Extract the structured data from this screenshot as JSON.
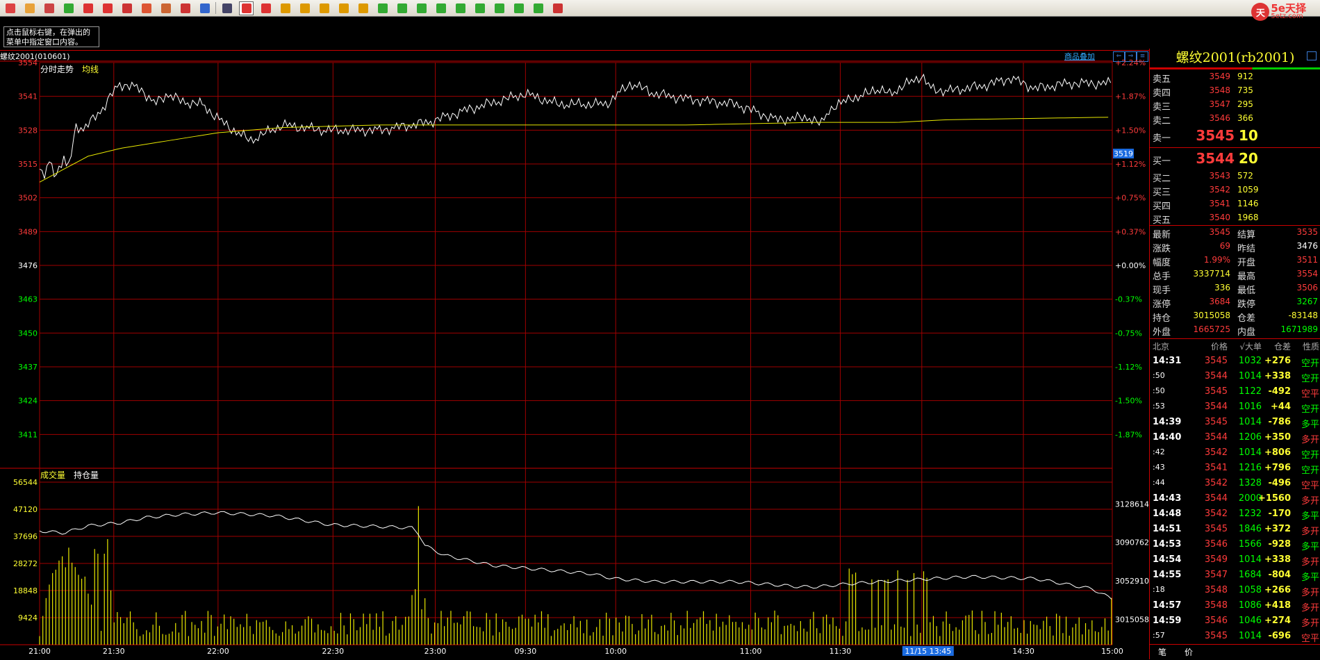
{
  "toolbar": {
    "buttons": [
      {
        "name": "home",
        "color": "#d44"
      },
      {
        "name": "folder",
        "color": "#e8a23a"
      },
      {
        "name": "card",
        "color": "#c44"
      },
      {
        "name": "refresh",
        "color": "#3a3"
      },
      {
        "name": "zoom-in",
        "color": "#d33"
      },
      {
        "name": "zoom-out",
        "color": "#d33"
      },
      {
        "name": "window",
        "color": "#c33"
      },
      {
        "name": "draw",
        "color": "#d53"
      },
      {
        "name": "palette",
        "color": "#c63"
      },
      {
        "name": "filter",
        "color": "#c33"
      },
      {
        "name": "news",
        "color": "#36c"
      }
    ],
    "period_buttons": [
      {
        "name": "table",
        "color": "#446"
      },
      {
        "name": "chart-active",
        "color": "#d33"
      },
      {
        "name": "tick",
        "color": "#d33"
      },
      {
        "name": "day",
        "color": "#d90"
      },
      {
        "name": "week",
        "color": "#d90"
      },
      {
        "name": "month",
        "color": "#d90"
      },
      {
        "name": "quarter",
        "color": "#d90"
      },
      {
        "name": "year",
        "color": "#d90"
      },
      {
        "name": "min1",
        "color": "#3a3"
      },
      {
        "name": "min3",
        "color": "#3a3"
      },
      {
        "name": "min5",
        "color": "#3a3"
      },
      {
        "name": "min15",
        "color": "#3a3"
      },
      {
        "name": "min30",
        "color": "#3a3"
      },
      {
        "name": "min60",
        "color": "#3a3"
      },
      {
        "name": "hour2",
        "color": "#3a3"
      },
      {
        "name": "hour4",
        "color": "#3a3"
      },
      {
        "name": "year-y",
        "color": "#3a3"
      },
      {
        "name": "calendar",
        "color": "#c33"
      }
    ]
  },
  "logo": {
    "badge": "天",
    "text": "5e天择",
    "sub": "5etz.com"
  },
  "hint": "点击鼠标右键，在弹出的菜单中指定窗口内容。",
  "symbol_title": "螺纹2001(010601)",
  "overlay_link": "商品叠加",
  "chart_data": {
    "type": "line",
    "title": "分时走势",
    "legend_avg": "均线",
    "price_ticks": [
      3554,
      3541,
      3528,
      3515,
      3502,
      3489,
      3476,
      3463,
      3450,
      3437,
      3424,
      3411
    ],
    "pct_ticks": [
      "+2.24%",
      "+1.87%",
      "+1.50%",
      "+1.12%",
      "+0.75%",
      "+0.37%",
      "+0.00%",
      "-0.37%",
      "-0.75%",
      "-1.12%",
      "-1.50%",
      "-1.87%"
    ],
    "ylim": [
      3398,
      3554
    ],
    "prev_settle": 3476,
    "current_marker": 3519,
    "x_labels": [
      "21:00",
      "21:30",
      "22:00",
      "22:30",
      "23:00",
      "09:30",
      "10:00",
      "11:00",
      "11:30",
      "11/15 13:45",
      "14:30",
      "15:00"
    ],
    "price_series_keypoints": [
      [
        0,
        3513
      ],
      [
        5,
        3509
      ],
      [
        12,
        3516
      ],
      [
        20,
        3511
      ],
      [
        30,
        3517
      ],
      [
        35,
        3512
      ],
      [
        45,
        3530
      ],
      [
        55,
        3528
      ],
      [
        70,
        3534
      ],
      [
        80,
        3537
      ],
      [
        88,
        3541
      ],
      [
        98,
        3546
      ],
      [
        108,
        3545
      ],
      [
        125,
        3544
      ],
      [
        142,
        3538
      ],
      [
        158,
        3542
      ],
      [
        175,
        3539
      ],
      [
        200,
        3538
      ],
      [
        230,
        3530
      ],
      [
        260,
        3524
      ],
      [
        300,
        3530
      ],
      [
        350,
        3528
      ],
      [
        420,
        3528
      ],
      [
        480,
        3531
      ],
      [
        530,
        3536
      ],
      [
        600,
        3542
      ],
      [
        640,
        3538
      ],
      [
        700,
        3538
      ],
      [
        730,
        3546
      ],
      [
        760,
        3542
      ],
      [
        800,
        3540
      ],
      [
        860,
        3538
      ],
      [
        910,
        3532
      ],
      [
        950,
        3533
      ],
      [
        965,
        3530
      ],
      [
        975,
        3536
      ],
      [
        990,
        3538
      ],
      [
        1002,
        3541
      ],
      [
        1012,
        3540
      ],
      [
        1030,
        3544
      ],
      [
        1050,
        3542
      ],
      [
        1090,
        3549
      ],
      [
        1100,
        3544
      ],
      [
        1120,
        3543
      ],
      [
        1165,
        3545
      ],
      [
        1200,
        3548
      ],
      [
        1230,
        3544
      ],
      [
        1270,
        3546
      ],
      [
        1307,
        3546
      ],
      [
        1325,
        3546
      ]
    ],
    "avg_series_keypoints": [
      [
        0,
        3508
      ],
      [
        30,
        3513
      ],
      [
        60,
        3518
      ],
      [
        100,
        3521
      ],
      [
        160,
        3524
      ],
      [
        220,
        3527
      ],
      [
        300,
        3529
      ],
      [
        420,
        3530
      ],
      [
        600,
        3530
      ],
      [
        800,
        3530
      ],
      [
        960,
        3531
      ],
      [
        1060,
        3531
      ],
      [
        1120,
        3532
      ],
      [
        1325,
        3533
      ]
    ],
    "volume": {
      "title": "成交量",
      "oi_label": "持仓量",
      "vol_ticks": [
        56544,
        47120,
        37696,
        28272,
        18848,
        9424
      ],
      "oi_ticks": [
        3128614,
        3090762,
        3052910,
        3015058
      ],
      "vol_max": 56544,
      "oi_range": [
        2990000,
        3150000
      ],
      "oi_keypoints": [
        [
          0,
          3102000
        ],
        [
          30,
          3100000
        ],
        [
          60,
          3107000
        ],
        [
          100,
          3110000
        ],
        [
          130,
          3115000
        ],
        [
          170,
          3118000
        ],
        [
          220,
          3120000
        ],
        [
          290,
          3117000
        ],
        [
          360,
          3108000
        ],
        [
          430,
          3106000
        ],
        [
          460,
          3105000
        ],
        [
          470,
          3098000
        ],
        [
          475,
          3088000
        ],
        [
          500,
          3078000
        ],
        [
          560,
          3068000
        ],
        [
          680,
          3060000
        ],
        [
          710,
          3055000
        ],
        [
          760,
          3052000
        ],
        [
          860,
          3052000
        ],
        [
          940,
          3047000
        ],
        [
          960,
          3047000
        ],
        [
          1000,
          3050000
        ],
        [
          1080,
          3054000
        ],
        [
          1150,
          3057000
        ],
        [
          1190,
          3056000
        ],
        [
          1230,
          3055000
        ],
        [
          1300,
          3045000
        ],
        [
          1325,
          3035000
        ]
      ]
    }
  },
  "quote": {
    "title": "螺纹2001(rb2001)",
    "asks": [
      {
        "label": "卖五",
        "price": "3549",
        "vol": "912"
      },
      {
        "label": "卖四",
        "price": "3548",
        "vol": "735"
      },
      {
        "label": "卖三",
        "price": "3547",
        "vol": "295"
      },
      {
        "label": "卖二",
        "price": "3546",
        "vol": "366"
      }
    ],
    "ask1": {
      "label": "卖一",
      "price": "3545",
      "vol": "10"
    },
    "bid1": {
      "label": "买一",
      "price": "3544",
      "vol": "20"
    },
    "bids": [
      {
        "label": "买二",
        "price": "3543",
        "vol": "572"
      },
      {
        "label": "买三",
        "price": "3542",
        "vol": "1059"
      },
      {
        "label": "买四",
        "price": "3541",
        "vol": "1146"
      },
      {
        "label": "买五",
        "price": "3540",
        "vol": "1968"
      }
    ],
    "stats": [
      {
        "l1": "最新",
        "v1": "3545",
        "c1": "red",
        "l2": "结算",
        "v2": "3535",
        "c2": "red"
      },
      {
        "l1": "涨跌",
        "v1": "69",
        "c1": "red",
        "l2": "昨结",
        "v2": "3476",
        "c2": "white"
      },
      {
        "l1": "幅度",
        "v1": "1.99%",
        "c1": "red",
        "l2": "开盘",
        "v2": "3511",
        "c2": "red"
      },
      {
        "l1": "总手",
        "v1": "3337714",
        "c1": "yellow",
        "l2": "最高",
        "v2": "3554",
        "c2": "red"
      },
      {
        "l1": "现手",
        "v1": "336",
        "c1": "yellow",
        "l2": "最低",
        "v2": "3506",
        "c2": "red"
      },
      {
        "l1": "涨停",
        "v1": "3684",
        "c1": "red",
        "l2": "跌停",
        "v2": "3267",
        "c2": "green"
      },
      {
        "l1": "持仓",
        "v1": "3015058",
        "c1": "yellow",
        "l2": "仓差",
        "v2": "-83148",
        "c2": "yellow"
      },
      {
        "l1": "外盘",
        "v1": "1665725",
        "c1": "red",
        "l2": "内盘",
        "v2": "1671989",
        "c2": "green"
      }
    ],
    "tick_header": {
      "time": "北京",
      "price": "价格",
      "vol": "√大单",
      "chg": "仓差",
      "nature": "性质"
    },
    "ticks": [
      {
        "time": "14:31",
        "price": "3545",
        "vol": "1032",
        "chg": "+276",
        "nature": "空开",
        "pc": "red",
        "nc": "green"
      },
      {
        "time": ":50",
        "price": "3544",
        "vol": "1014",
        "chg": "+338",
        "nature": "空开",
        "pc": "red",
        "nc": "green"
      },
      {
        "time": ":50",
        "price": "3545",
        "vol": "1122",
        "chg": "-492",
        "nature": "空平",
        "pc": "red",
        "nc": "red"
      },
      {
        "time": ":53",
        "price": "3544",
        "vol": "1016",
        "chg": "+44",
        "nature": "空开",
        "pc": "red",
        "nc": "green"
      },
      {
        "time": "14:39",
        "price": "3545",
        "vol": "1014",
        "chg": "-786",
        "nature": "多平",
        "pc": "red",
        "nc": "green"
      },
      {
        "time": "14:40",
        "price": "3544",
        "vol": "1206",
        "chg": "+350",
        "nature": "多开",
        "pc": "red",
        "nc": "red"
      },
      {
        "time": ":42",
        "price": "3542",
        "vol": "1014",
        "chg": "+806",
        "nature": "空开",
        "pc": "red",
        "nc": "green"
      },
      {
        "time": ":43",
        "price": "3541",
        "vol": "1216",
        "chg": "+796",
        "nature": "空开",
        "pc": "red",
        "nc": "green"
      },
      {
        "time": ":44",
        "price": "3542",
        "vol": "1328",
        "chg": "-496",
        "nature": "空平",
        "pc": "red",
        "nc": "red"
      },
      {
        "time": "14:43",
        "price": "3544",
        "vol": "2000",
        "chg": "+1560",
        "nature": "多开",
        "pc": "red",
        "nc": "red"
      },
      {
        "time": "14:48",
        "price": "3542",
        "vol": "1232",
        "chg": "-170",
        "nature": "多平",
        "pc": "red",
        "nc": "green"
      },
      {
        "time": "14:51",
        "price": "3545",
        "vol": "1846",
        "chg": "+372",
        "nature": "多开",
        "pc": "red",
        "nc": "red"
      },
      {
        "time": "14:53",
        "price": "3546",
        "vol": "1566",
        "chg": "-928",
        "nature": "多平",
        "pc": "red",
        "nc": "green"
      },
      {
        "time": "14:54",
        "price": "3549",
        "vol": "1014",
        "chg": "+338",
        "nature": "多开",
        "pc": "red",
        "nc": "red"
      },
      {
        "time": "14:55",
        "price": "3547",
        "vol": "1684",
        "chg": "-804",
        "nature": "多平",
        "pc": "red",
        "nc": "green"
      },
      {
        "time": ":18",
        "price": "3548",
        "vol": "1058",
        "chg": "+266",
        "nature": "多开",
        "pc": "red",
        "nc": "red"
      },
      {
        "time": "14:57",
        "price": "3548",
        "vol": "1086",
        "chg": "+418",
        "nature": "多开",
        "pc": "red",
        "nc": "red"
      },
      {
        "time": "14:59",
        "price": "3546",
        "vol": "1046",
        "chg": "+274",
        "nature": "多开",
        "pc": "red",
        "nc": "red"
      },
      {
        "time": ":57",
        "price": "3545",
        "vol": "1014",
        "chg": "-696",
        "nature": "空平",
        "pc": "red",
        "nc": "red"
      }
    ],
    "footer": [
      "笔",
      "价"
    ]
  },
  "colors": {
    "grid": "#a00000",
    "price_line": "#ffffff",
    "avg_line": "#e8e800",
    "volume_bar": "#e8e800",
    "up": "#ff3b3b",
    "down": "#00ff00"
  }
}
